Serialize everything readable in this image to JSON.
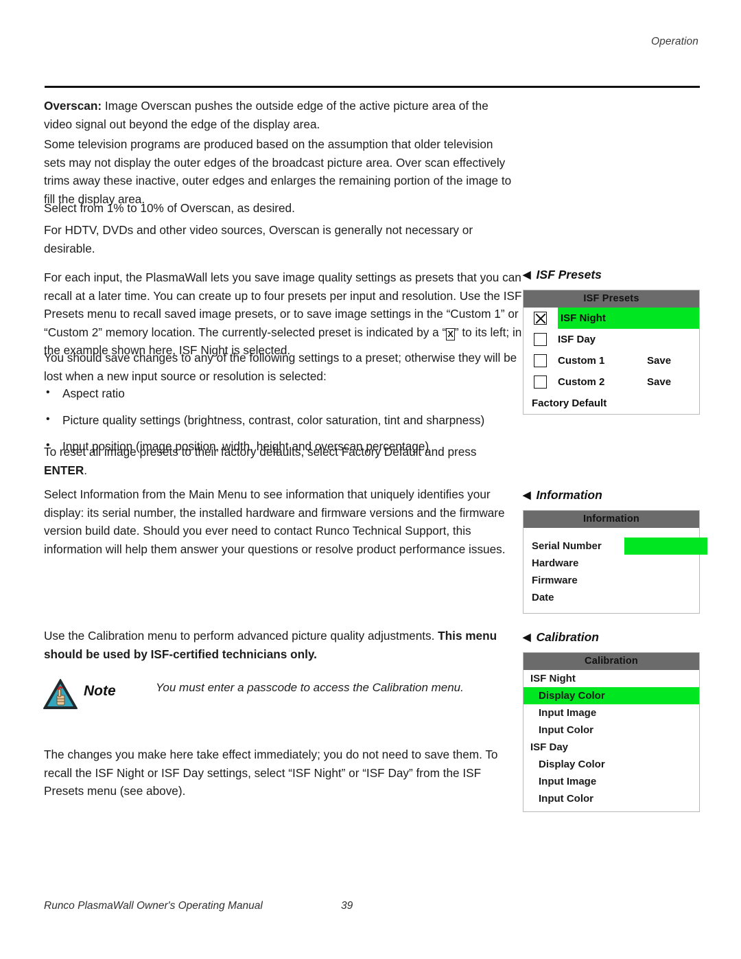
{
  "header": {
    "running_head": "Operation"
  },
  "footer": {
    "manual_title": "Runco PlasmaWall Owner's Operating Manual",
    "page_number": "39"
  },
  "body": {
    "overscan_label": "Overscan:",
    "overscan_text": " Image Overscan pushes the outside edge of the active picture area of the video signal out beyond the edge of the display area.",
    "some_tv": "Some television programs are produced based on the assumption that older television sets may not display the outer edges of the broadcast picture area. Over scan effectively trims away these inactive, outer edges and enlarges the remaining portion of the image to fill the display area.",
    "select_range": "Select from 1% to 10% of Overscan, as desired.",
    "hdtv": "For HDTV, DVDs and other video sources, Overscan is generally not necessary or desirable.",
    "foreach_part1": "For each input, the PlasmaWall lets you save image quality settings as presets that you can recall at a later time. You can create up to four presets per input and resolution. Use the ISF Presets menu to recall saved image presets, or to save image settings in the “Custom 1” or “Custom 2” memory location. The currently-selected preset is indicated by a “",
    "foreach_glyph": "X",
    "foreach_part2": "” to its left; in the example shown here, ISF Night is selected.",
    "you_should": "You should save changes to any of the following settings to a preset; otherwise they will be lost when a new input source or resolution is selected:",
    "bullets": [
      "Aspect ratio",
      "Picture quality settings (brightness, contrast, color saturation, tint and sharpness)",
      "Input position (image position, width, height and overscan percentage)"
    ],
    "to_reset_part1": "To reset all image presets to their factory defaults, select Factory Default and press ",
    "to_reset_enter": "ENTER",
    "to_reset_part2": ".",
    "select_information": "Select Information from the Main Menu to see information that uniquely identifies your display: its serial number, the installed hardware and firmware versions and the firmware version build date. Should you ever need to contact Runco Technical Support, this information will help them answer your questions or resolve product performance issues.",
    "use_calibration_plain": "Use the Calibration menu to perform advanced picture quality adjustments. ",
    "use_calibration_bold": "This menu should be used by ISF-certified technicians only.",
    "changes_immediate": "The changes you make here take effect immediately; you do not need to save them. To recall the ISF Night or ISF Day settings, select “ISF Night” or “ISF Day” from the ISF Presets menu (see above)."
  },
  "note": {
    "label": "Note",
    "text": "You must enter a passcode to access the Calibration menu.",
    "icon": "warning-triangle-hand-icon"
  },
  "figures": {
    "isf_presets": {
      "caption": "ISF Presets",
      "caption_arrow": "◀",
      "title": "ISF Presets",
      "rows": [
        {
          "checkbox": true,
          "checked": true,
          "label": "ISF Night",
          "highlight": true,
          "action": ""
        },
        {
          "checkbox": true,
          "checked": false,
          "label": "ISF Day",
          "highlight": false,
          "action": ""
        },
        {
          "checkbox": true,
          "checked": false,
          "label": "Custom 1",
          "highlight": false,
          "action": "Save"
        },
        {
          "checkbox": true,
          "checked": false,
          "label": "Custom 2",
          "highlight": false,
          "action": "Save"
        },
        {
          "checkbox": false,
          "checked": false,
          "label": "Factory Default",
          "highlight": false,
          "action": ""
        }
      ]
    },
    "information": {
      "caption": "Information",
      "caption_arrow": "◀",
      "title": "Information",
      "rows": [
        {
          "key": "Serial Number",
          "value_bar": true
        },
        {
          "key": "Hardware",
          "value_bar": false
        },
        {
          "key": "Firmware",
          "value_bar": false
        },
        {
          "key": "Date",
          "value_bar": false
        }
      ]
    },
    "calibration": {
      "caption": "Calibration",
      "caption_arrow": "◀",
      "title": "Calibration",
      "rows": [
        {
          "label": "ISF Night",
          "indent": false,
          "highlight": false
        },
        {
          "label": "Display Color",
          "indent": true,
          "highlight": true
        },
        {
          "label": "Input Image",
          "indent": true,
          "highlight": false
        },
        {
          "label": "Input Color",
          "indent": true,
          "highlight": false
        },
        {
          "label": "ISF Day",
          "indent": false,
          "highlight": false
        },
        {
          "label": "Display Color",
          "indent": true,
          "highlight": false
        },
        {
          "label": "Input Image",
          "indent": true,
          "highlight": false
        },
        {
          "label": "Input Color",
          "indent": true,
          "highlight": false
        }
      ]
    }
  },
  "colors": {
    "highlight_green": "#00e721",
    "osd_title_gray": "#6b6b6b",
    "note_triangle_teal": "#33a6bd"
  }
}
